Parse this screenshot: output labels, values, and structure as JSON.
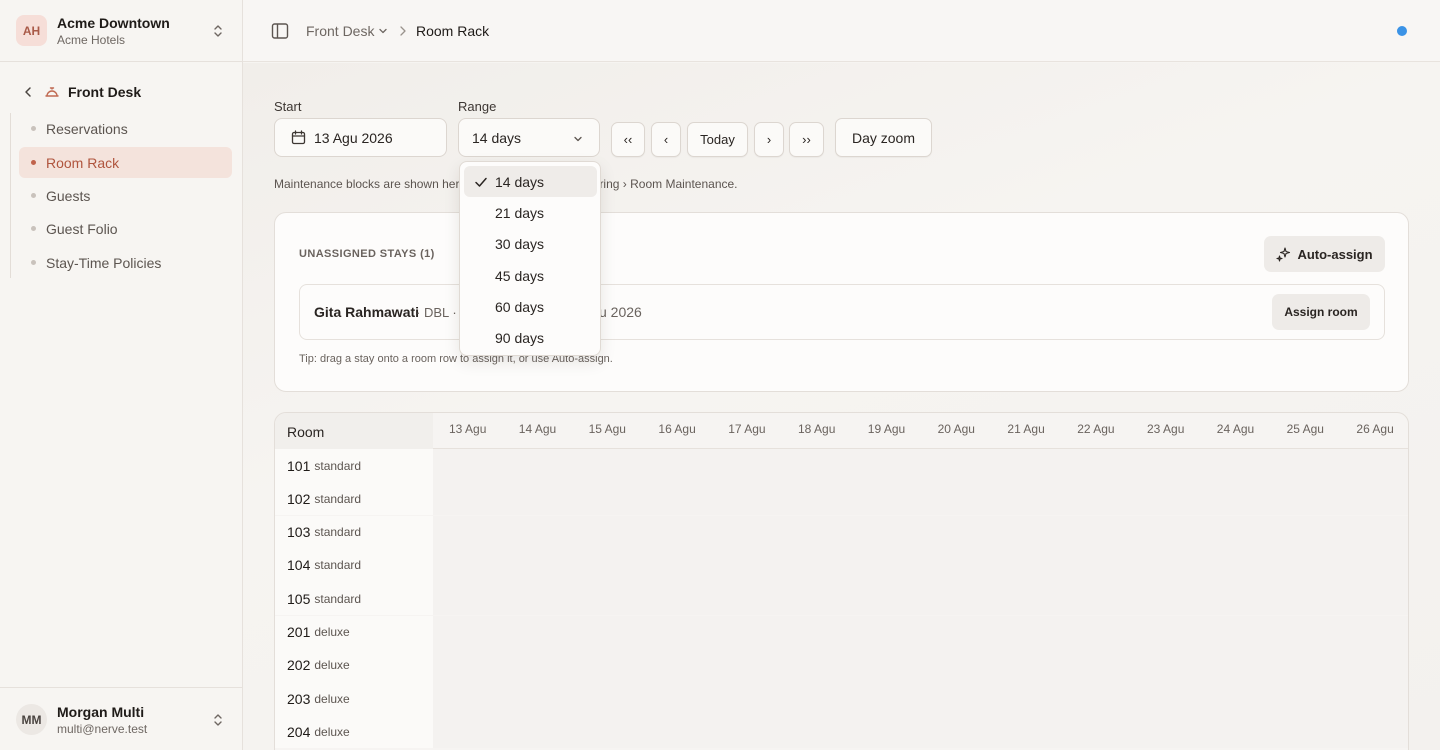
{
  "org": {
    "initials": "AH",
    "name": "Acme Downtown",
    "sub": "Acme Hotels"
  },
  "sidebar": {
    "section": "Front Desk",
    "items": [
      {
        "label": "Reservations",
        "active": false
      },
      {
        "label": "Room Rack",
        "active": true
      },
      {
        "label": "Guests",
        "active": false
      },
      {
        "label": "Guest Folio",
        "active": false
      },
      {
        "label": "Stay-Time Policies",
        "active": false
      }
    ]
  },
  "user": {
    "initials": "MM",
    "name": "Morgan Multi",
    "email": "multi@nerve.test"
  },
  "topbar": {
    "crumb1": "Front Desk",
    "crumb2": "Room Rack",
    "status_color": "#3b93e6"
  },
  "controls": {
    "start_label": "Start",
    "start_value": "13 Agu 2026",
    "range_label": "Range",
    "range_value": "14 days",
    "first_btn": "‹‹",
    "prev_btn": "‹",
    "today_btn": "Today",
    "next_btn": "›",
    "last_btn": "››",
    "zoom_btn": "Day zoom"
  },
  "note_start": "Maintenance blocks are shown her",
  "note_end": "ring › Room Maintenance.",
  "unassigned": {
    "title": "UNASSIGNED STAYS (1)",
    "auto_assign": "Auto-assign",
    "stay_name": "Gita Rahmawati",
    "stay_meta": "· DBL ·",
    "stay_date": "u 2026",
    "assign_btn": "Assign room",
    "tip": "Tip: drag a stay onto a room row to assign it, or use Auto-assign."
  },
  "grid": {
    "room_header": "Room",
    "days": [
      "13 Agu",
      "14 Agu",
      "15 Agu",
      "16 Agu",
      "17 Agu",
      "18 Agu",
      "19 Agu",
      "20 Agu",
      "21 Agu",
      "22 Agu",
      "23 Agu",
      "24 Agu",
      "25 Agu",
      "26 Agu"
    ],
    "rooms": [
      {
        "number": "101",
        "type": "standard"
      },
      {
        "number": "102",
        "type": "standard"
      },
      {
        "number": "103",
        "type": "standard"
      },
      {
        "number": "104",
        "type": "standard"
      },
      {
        "number": "105",
        "type": "standard"
      },
      {
        "number": "201",
        "type": "deluxe"
      },
      {
        "number": "202",
        "type": "deluxe"
      },
      {
        "number": "203",
        "type": "deluxe"
      },
      {
        "number": "204",
        "type": "deluxe"
      }
    ]
  },
  "range_options": [
    "14 days",
    "21 days",
    "30 days",
    "45 days",
    "60 days",
    "90 days"
  ],
  "range_selected": "14 days"
}
